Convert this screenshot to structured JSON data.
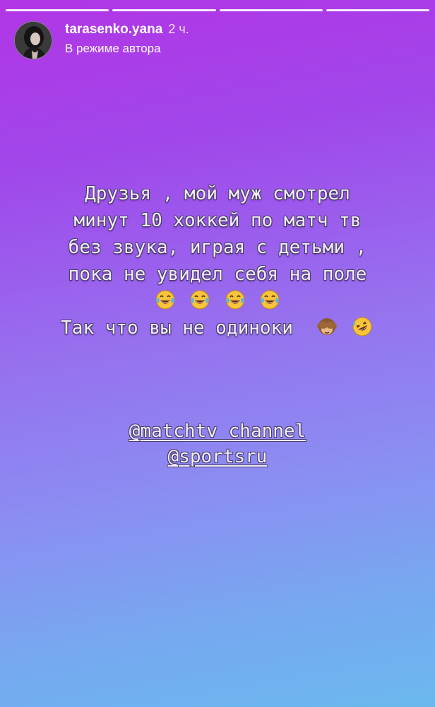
{
  "story": {
    "progress_segments": 4,
    "progress_color": "#ffffff",
    "background": {
      "top": "#b235e6",
      "middle": "#9672ef",
      "bottom": "#6bb8ee"
    }
  },
  "header": {
    "username": "tarasenko.yana",
    "time": "2 ч.",
    "subtitle": "В режиме автора",
    "avatar": "profile-photo"
  },
  "text": {
    "lines": [
      "Друзья , мой муж смотрел",
      "минут 10 хоккей по матч тв",
      "без звука, играя с детьми ,",
      "пока не увидел себя на поле",
      "Так что вы не одиноки"
    ],
    "emojis_line": [
      "tears-of-joy-emoji",
      "tears-of-joy-emoji",
      "tears-of-joy-emoji",
      "tears-of-joy-emoji"
    ],
    "emojis_after_last": [
      "see-no-evil-monkey-emoji",
      "rolling-on-floor-laughing-emoji"
    ]
  },
  "mentions": {
    "first_prefix": "@",
    "first": "matchtv_channel",
    "second_prefix": "@",
    "second": "sportsru"
  }
}
